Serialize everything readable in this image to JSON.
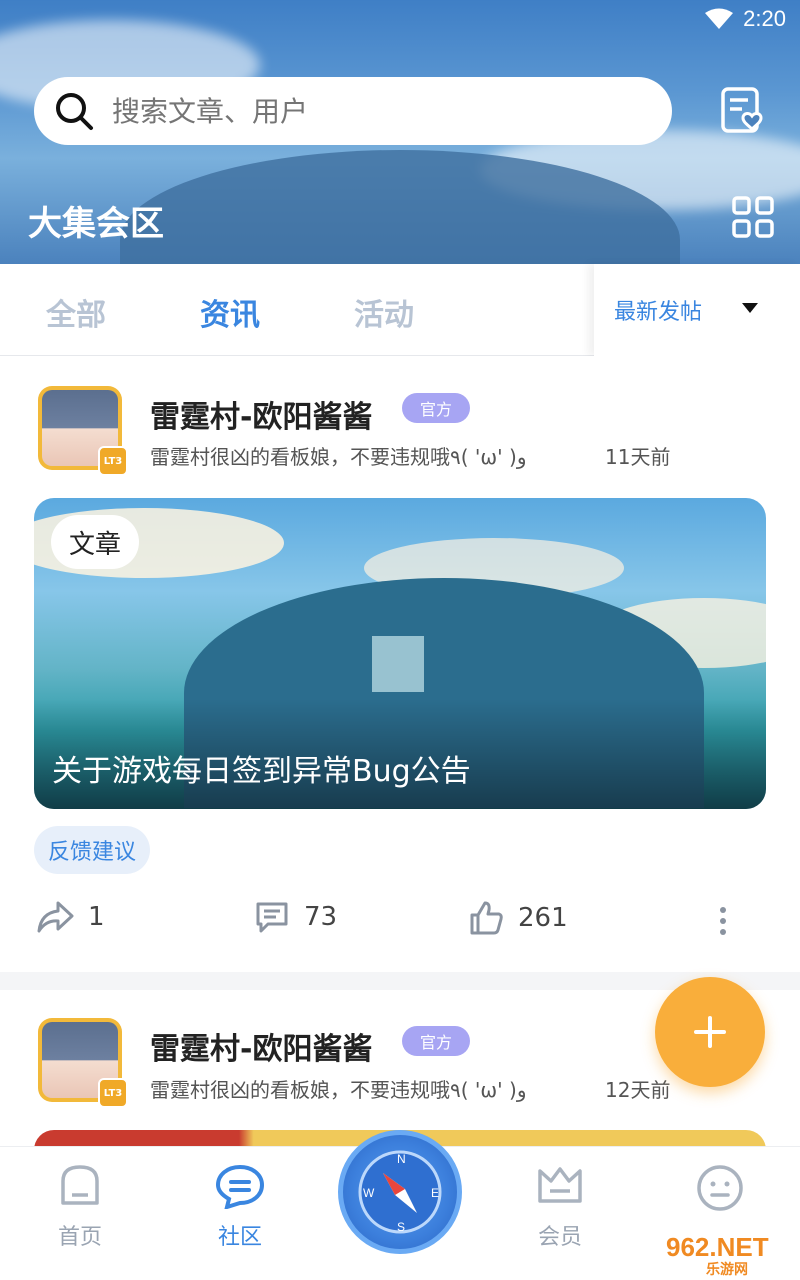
{
  "status": {
    "time": "2:20"
  },
  "search": {
    "placeholder": "搜索文章、用户"
  },
  "header": {
    "title": "大集会区"
  },
  "tabs": [
    {
      "label": "全部"
    },
    {
      "label": "资讯"
    },
    {
      "label": "活动"
    }
  ],
  "active_tab": "资讯",
  "sort": {
    "label": "最新发帖"
  },
  "posts": [
    {
      "author": "雷霆村-欧阳酱酱",
      "badge": "官方",
      "level": "LT3",
      "signature": "雷霆村很凶的看板娘，不要违规哦٩( 'ω' )و",
      "time": "11天前",
      "type_tag": "文章",
      "title": "关于游戏每日签到异常Bug公告",
      "topic": "反馈建议",
      "shares": "1",
      "comments": "73",
      "likes": "261"
    },
    {
      "author": "雷霆村-欧阳酱酱",
      "badge": "官方",
      "level": "LT3",
      "signature": "雷霆村很凶的看板娘，不要违规哦٩( 'ω' )و",
      "time": "12天前"
    }
  ],
  "nav": [
    {
      "label": "首页"
    },
    {
      "label": "社区"
    },
    {
      "label": "会员"
    }
  ],
  "watermark": {
    "main": "962.NET",
    "sub": "乐游网"
  },
  "colors": {
    "accent": "#3a86e0",
    "fab": "#f9ae3b",
    "official_badge": "#a7a5f3"
  }
}
